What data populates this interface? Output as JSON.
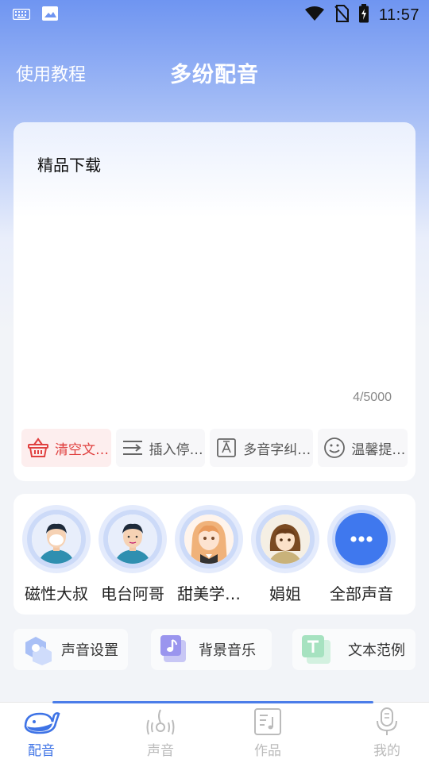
{
  "status_bar": {
    "time": "11:57"
  },
  "header": {
    "tutorial_label": "使用教程",
    "title": "多纷配音"
  },
  "editor": {
    "text": "精品下载",
    "counter": "4/5000",
    "tools": [
      {
        "label": "清空文…",
        "icon": "basket-icon"
      },
      {
        "label": "插入停…",
        "icon": "pause-lines-icon"
      },
      {
        "label": "多音字纠…",
        "icon": "text-a-icon"
      },
      {
        "label": "温馨提…",
        "icon": "smile-icon"
      }
    ]
  },
  "voices": [
    {
      "name": "磁性大叔",
      "avatar": "man-avatar"
    },
    {
      "name": "电台阿哥",
      "avatar": "man-avatar"
    },
    {
      "name": "甜美学…",
      "avatar": "girl-avatar"
    },
    {
      "name": "娟姐",
      "avatar": "woman-avatar"
    },
    {
      "name": "全部声音",
      "avatar": "more-dots-icon"
    }
  ],
  "options": [
    {
      "label": "声音设置",
      "icon": "hexagon-settings-icon"
    },
    {
      "label": "背景音乐",
      "icon": "music-note-icon"
    },
    {
      "label": "文本范例",
      "icon": "text-t-icon"
    }
  ],
  "tabs": [
    {
      "label": "配音",
      "icon": "whale-icon",
      "active": true
    },
    {
      "label": "声音",
      "icon": "sound-icon",
      "active": false
    },
    {
      "label": "作品",
      "icon": "music-file-icon",
      "active": false
    },
    {
      "label": "我的",
      "icon": "microphone-icon",
      "active": false
    }
  ],
  "colors": {
    "accent": "#3e73e6",
    "clear_red": "#e0403f",
    "voice_ring": "#ccdaf8"
  }
}
